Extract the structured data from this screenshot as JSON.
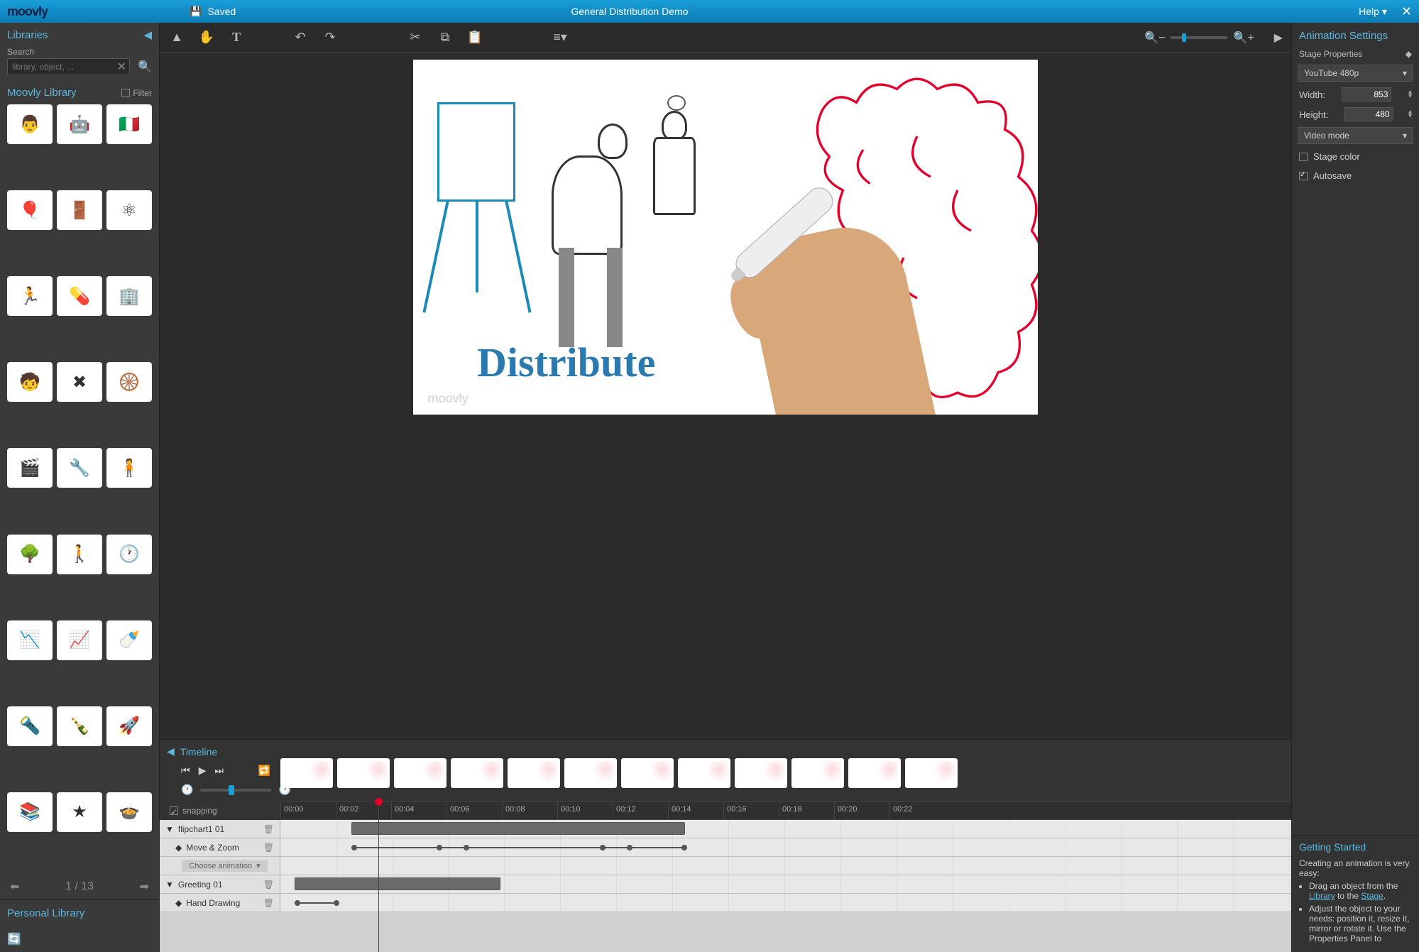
{
  "titlebar": {
    "logo": "moovly",
    "saved": "Saved",
    "title": "General Distribution Demo",
    "help": "Help"
  },
  "left": {
    "libraries": "Libraries",
    "search_label": "Search",
    "search_placeholder": "library, object, ...",
    "moovly_library": "Moovly Library",
    "filter": "Filter",
    "pager": "1 / 13",
    "personal_library": "Personal Library",
    "items": [
      "👨",
      "🤖",
      "🇮🇹",
      "🎈",
      "🚪",
      "⚛",
      "🏃",
      "💊",
      "🏢",
      "🧒",
      "✖",
      "🛞",
      "🎬",
      "🔧",
      "🧍",
      "🌳",
      "🚶",
      "🕐",
      "📉",
      "📈",
      "🍼",
      "🔦",
      "🍾",
      "🚀",
      "📚",
      "★",
      "🍲"
    ]
  },
  "stage": {
    "text": "Distribute",
    "watermark": "moovly"
  },
  "right": {
    "animation_settings": "Animation Settings",
    "stage_properties": "Stage Properties",
    "preset": "YouTube 480p",
    "width_label": "Width:",
    "width_value": "853",
    "height_label": "Height:",
    "height_value": "480",
    "video_mode": "Video mode",
    "stage_color": "Stage color",
    "autosave": "Autosave",
    "gs_title": "Getting Started",
    "gs_intro": "Creating an animation is very easy:",
    "gs_item1_a": "Drag an object from the ",
    "gs_item1_link1": "Library",
    "gs_item1_b": " to the ",
    "gs_item1_link2": "Stage",
    "gs_item1_c": ".",
    "gs_item2": "Adjust the object to your needs: position it, resize it, mirror or rotate it. Use the Properties Panel to"
  },
  "timeline": {
    "title": "Timeline",
    "snapping": "snapping",
    "ticks": [
      "00:00",
      "00:02",
      "00:04",
      "00:06",
      "00:08",
      "00:10",
      "00:12",
      "00:14",
      "00:16",
      "00:18",
      "00:20",
      "00:22"
    ],
    "track1": "flipchart1 01",
    "track1_sub": "Move & Zoom",
    "choose_anim": "Choose animation",
    "track2": "Greeting 01",
    "track2_sub": "Hand Drawing"
  }
}
